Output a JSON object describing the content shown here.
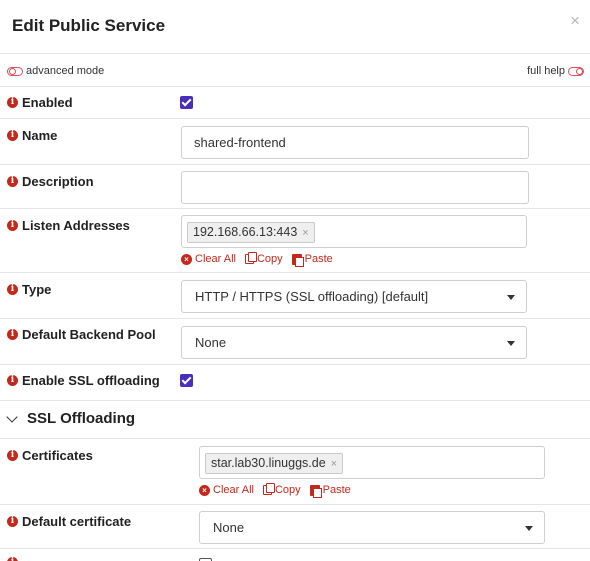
{
  "dialog": {
    "title": "Edit Public Service",
    "close_glyph": "×"
  },
  "toolbar": {
    "advanced_mode_label": "advanced mode",
    "full_help_label": "full help"
  },
  "fields": {
    "enabled": {
      "label": "Enabled",
      "checked": true
    },
    "name": {
      "label": "Name",
      "value": "shared-frontend"
    },
    "description": {
      "label": "Description",
      "value": ""
    },
    "listen_addresses": {
      "label": "Listen Addresses",
      "tags": [
        "192.168.66.13:443"
      ],
      "actions": {
        "clear": "Clear All",
        "copy": "Copy",
        "paste": "Paste"
      }
    },
    "type": {
      "label": "Type",
      "selected": "HTTP / HTTPS (SSL offloading) [default]"
    },
    "default_backend_pool": {
      "label": "Default Backend Pool",
      "selected": "None"
    },
    "enable_ssl_offloading": {
      "label": "Enable SSL offloading",
      "checked": true
    }
  },
  "ssl_section": {
    "title": "SSL Offloading",
    "certificates": {
      "label": "Certificates",
      "tags": [
        "star.lab30.linuggs.de"
      ],
      "actions": {
        "clear": "Clear All",
        "copy": "Copy",
        "paste": "Paste"
      }
    },
    "default_certificate": {
      "label": "Default certificate",
      "selected": "None"
    }
  },
  "icons": {
    "tag_remove": "×",
    "info": "i",
    "clear": "×"
  },
  "colors": {
    "accent": "#c4281c",
    "checkbox": "#4a2fbd",
    "toggle": "#d94f5c"
  }
}
